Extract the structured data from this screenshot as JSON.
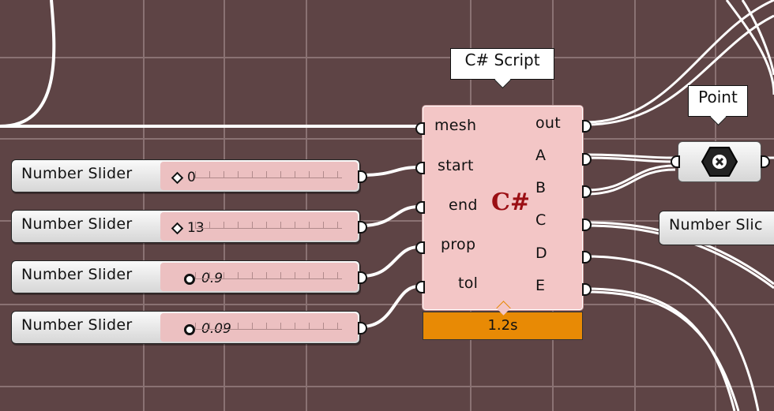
{
  "canvas": {
    "background": "#5e4445",
    "grid_color": "#8a7273",
    "wire_color": "#ffffff"
  },
  "sliders": [
    {
      "label": "Number Slider",
      "value": "0",
      "marker": "diamond"
    },
    {
      "label": "Number Slider",
      "value": "13",
      "marker": "diamond"
    },
    {
      "label": "Number Slider",
      "value": "0.9",
      "marker": "circle"
    },
    {
      "label": "Number Slider",
      "value": "0.09",
      "marker": "circle"
    }
  ],
  "script_component": {
    "tooltip": "C# Script",
    "inputs": [
      "mesh",
      "start",
      "end",
      "prop",
      "tol"
    ],
    "outputs": [
      "out",
      "A",
      "B",
      "C",
      "D",
      "E"
    ],
    "logo": "C#",
    "runtime": "1.2s",
    "body_color": "#f3c6c6",
    "runtime_color": "#e88a05"
  },
  "point_component": {
    "tooltip": "Point",
    "icon": "point-x-icon"
  },
  "right_slider_partial": {
    "label": "Number Slic"
  }
}
